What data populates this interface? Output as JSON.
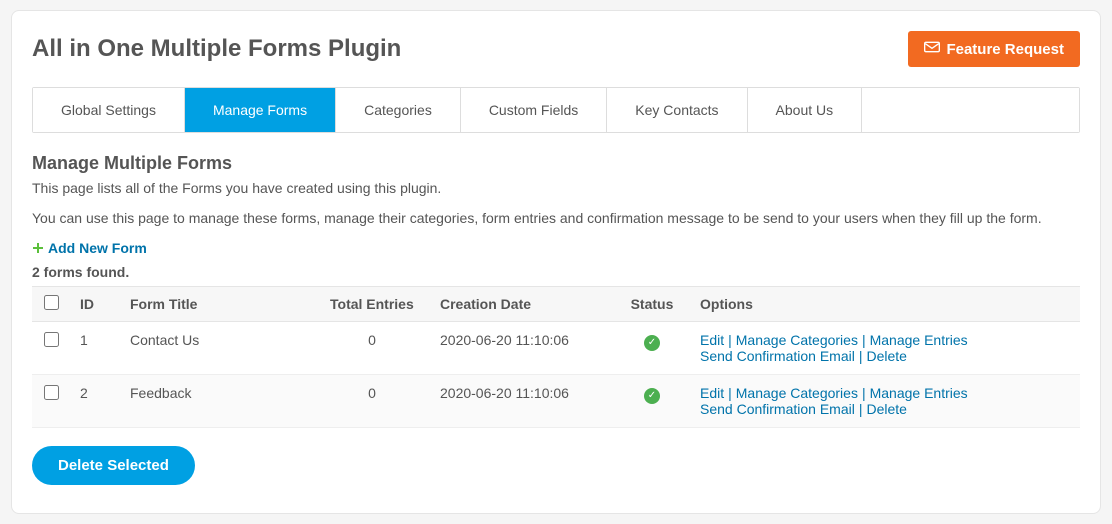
{
  "header": {
    "title": "All in One Multiple Forms Plugin",
    "feature_request_label": "Feature Request"
  },
  "tabs": [
    {
      "label": "Global Settings",
      "active": false
    },
    {
      "label": "Manage Forms",
      "active": true
    },
    {
      "label": "Categories",
      "active": false
    },
    {
      "label": "Custom Fields",
      "active": false
    },
    {
      "label": "Key Contacts",
      "active": false
    },
    {
      "label": "About Us",
      "active": false
    }
  ],
  "section": {
    "title": "Manage Multiple Forms",
    "desc1": "This page lists all of the Forms you have created using this plugin.",
    "desc2": "You can use this page to manage these forms, manage their categories, form entries and confirmation message to be send to your users when they fill up the form.",
    "add_new_label": "Add New Form",
    "count_text": "2 forms found."
  },
  "table": {
    "headers": {
      "id": "ID",
      "form_title": "Form Title",
      "total_entries": "Total Entries",
      "creation_date": "Creation Date",
      "status": "Status",
      "options": "Options"
    },
    "option_labels": {
      "edit": "Edit",
      "manage_categories": "Manage Categories",
      "manage_entries": "Manage Entries",
      "send_confirmation": "Send Confirmation Email",
      "delete": "Delete"
    },
    "rows": [
      {
        "id": "1",
        "title": "Contact Us",
        "entries": "0",
        "date": "2020-06-20 11:10:06",
        "status": "active"
      },
      {
        "id": "2",
        "title": "Feedback",
        "entries": "0",
        "date": "2020-06-20 11:10:06",
        "status": "active"
      }
    ]
  },
  "buttons": {
    "delete_selected": "Delete Selected"
  },
  "colors": {
    "accent": "#00a0e3",
    "feature_btn": "#f26a21",
    "link": "#0073aa",
    "status_ok": "#4caf50"
  }
}
